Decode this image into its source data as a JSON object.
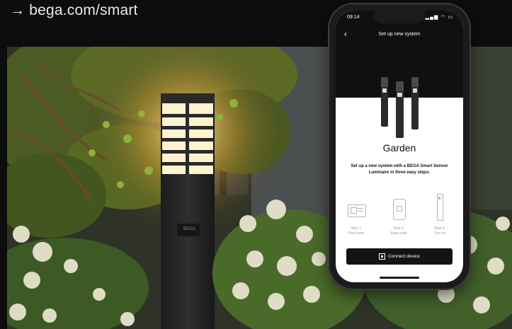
{
  "url_text": "→ bega.com/smart",
  "photo": {
    "bollard_badge": "BEGA"
  },
  "phone": {
    "status": {
      "time": "09:14",
      "icons": "▂▄▆ ◠ ▭"
    },
    "nav": {
      "back_icon": "chevron-left-icon",
      "title": "Set up new system"
    },
    "system_name": "Garden",
    "description_line1": "Set up a new system with a BEGA Smart Sensor",
    "description_line2": "Luminaire in three easy steps:",
    "steps": [
      {
        "line1": "Step 1:",
        "line2": "Find code"
      },
      {
        "line1": "Step 2:",
        "line2": "Scan code"
      },
      {
        "line1": "Step 3:",
        "line2": "Turn on"
      }
    ],
    "connect_button": {
      "icon": "qr-code-icon",
      "label": "Connect device"
    }
  },
  "colors": {
    "background": "#0d0d0d",
    "screen_header": "#101010",
    "button": "#141414",
    "lamp_glow": "#ffd995"
  }
}
